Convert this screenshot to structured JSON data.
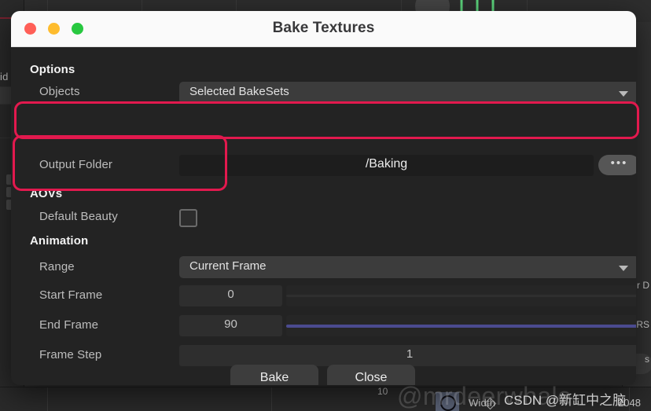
{
  "dialog": {
    "title": "Bake Textures",
    "traffic_lights": [
      {
        "name": "close-button",
        "color": "#ff5f57"
      },
      {
        "name": "minimize-button",
        "color": "#febc2e"
      },
      {
        "name": "maximize-button",
        "color": "#28c840"
      }
    ],
    "sections": {
      "options": {
        "heading": "Options",
        "objects": {
          "label": "Objects",
          "value": "Selected BakeSets",
          "options": [
            "Selected BakeSets"
          ]
        },
        "output_folder": {
          "label": "Output Folder",
          "value": "/Baking",
          "ghost_value": "",
          "browse_label": "•••"
        }
      },
      "aovs": {
        "heading": "AOVs",
        "default_beauty": {
          "label": "Default Beauty",
          "checked": false
        }
      },
      "animation": {
        "heading": "Animation",
        "range": {
          "label": "Range",
          "value": "Current Frame",
          "options": [
            "Current Frame"
          ]
        },
        "start_frame": {
          "label": "Start Frame",
          "value": "0",
          "slider_percent": 0
        },
        "end_frame": {
          "label": "End Frame",
          "value": "90",
          "slider_percent": 100
        },
        "frame_step": {
          "label": "Frame Step",
          "value": "1"
        }
      }
    },
    "buttons": {
      "bake": "Bake",
      "close": "Close"
    }
  },
  "annotations": {
    "color": "#e2194e",
    "boxes": [
      "output-folder-highlight",
      "aovs-highlight"
    ]
  },
  "watermarks": {
    "handle": "@mrdeerwhale",
    "csdn": "CSDN @新缸中之脑"
  },
  "background": {
    "left_panel_label": "id",
    "right_labels": [
      "r D",
      "RS",
      "s"
    ],
    "bottom_status": {
      "number": "10",
      "width_label": "Width",
      "width_value": "2048"
    }
  }
}
